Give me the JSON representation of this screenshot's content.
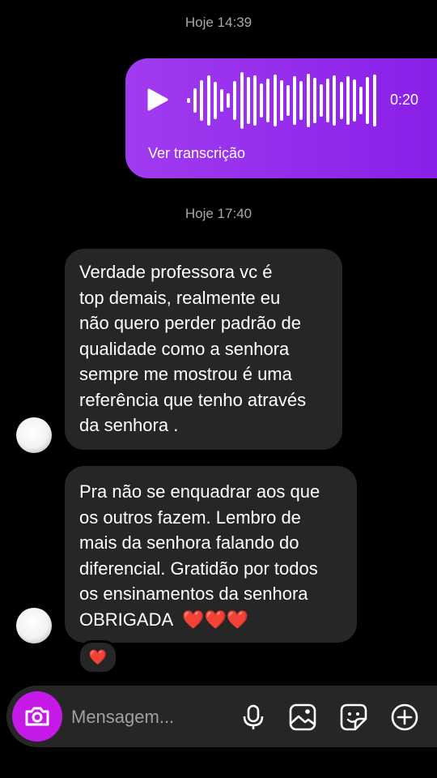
{
  "timestamps": [
    "Hoje 14:39",
    "Hoje 17:40"
  ],
  "audio_message": {
    "duration": "0:20",
    "transcript_link": "Ver transcrição",
    "icon": "play-icon",
    "color_start": "#a13bf0",
    "color_end": "#8a1fe8"
  },
  "messages": [
    {
      "lines": [
        "Verdade professora vc é",
        "top demais, realmente eu",
        "não quero perder padrão de",
        "qualidade como a senhora",
        "sempre me mostrou é uma",
        "referência que tenho através",
        "da senhora ."
      ]
    },
    {
      "lines": [
        "Pra não se enquadrar aos que",
        "os outros fazem. Lembro de",
        "mais da senhora falando do",
        "diferencial. Gratidão por todos",
        "os ensinamentos da senhora",
        "OBRIGADA  ❤️❤️❤️"
      ],
      "reaction": "❤️"
    }
  ],
  "composer": {
    "placeholder": "Mensagem...",
    "camera_color": "#c519e8",
    "icons": [
      "camera-icon",
      "microphone-icon",
      "gallery-icon",
      "sticker-icon",
      "plus-circle-icon"
    ]
  }
}
